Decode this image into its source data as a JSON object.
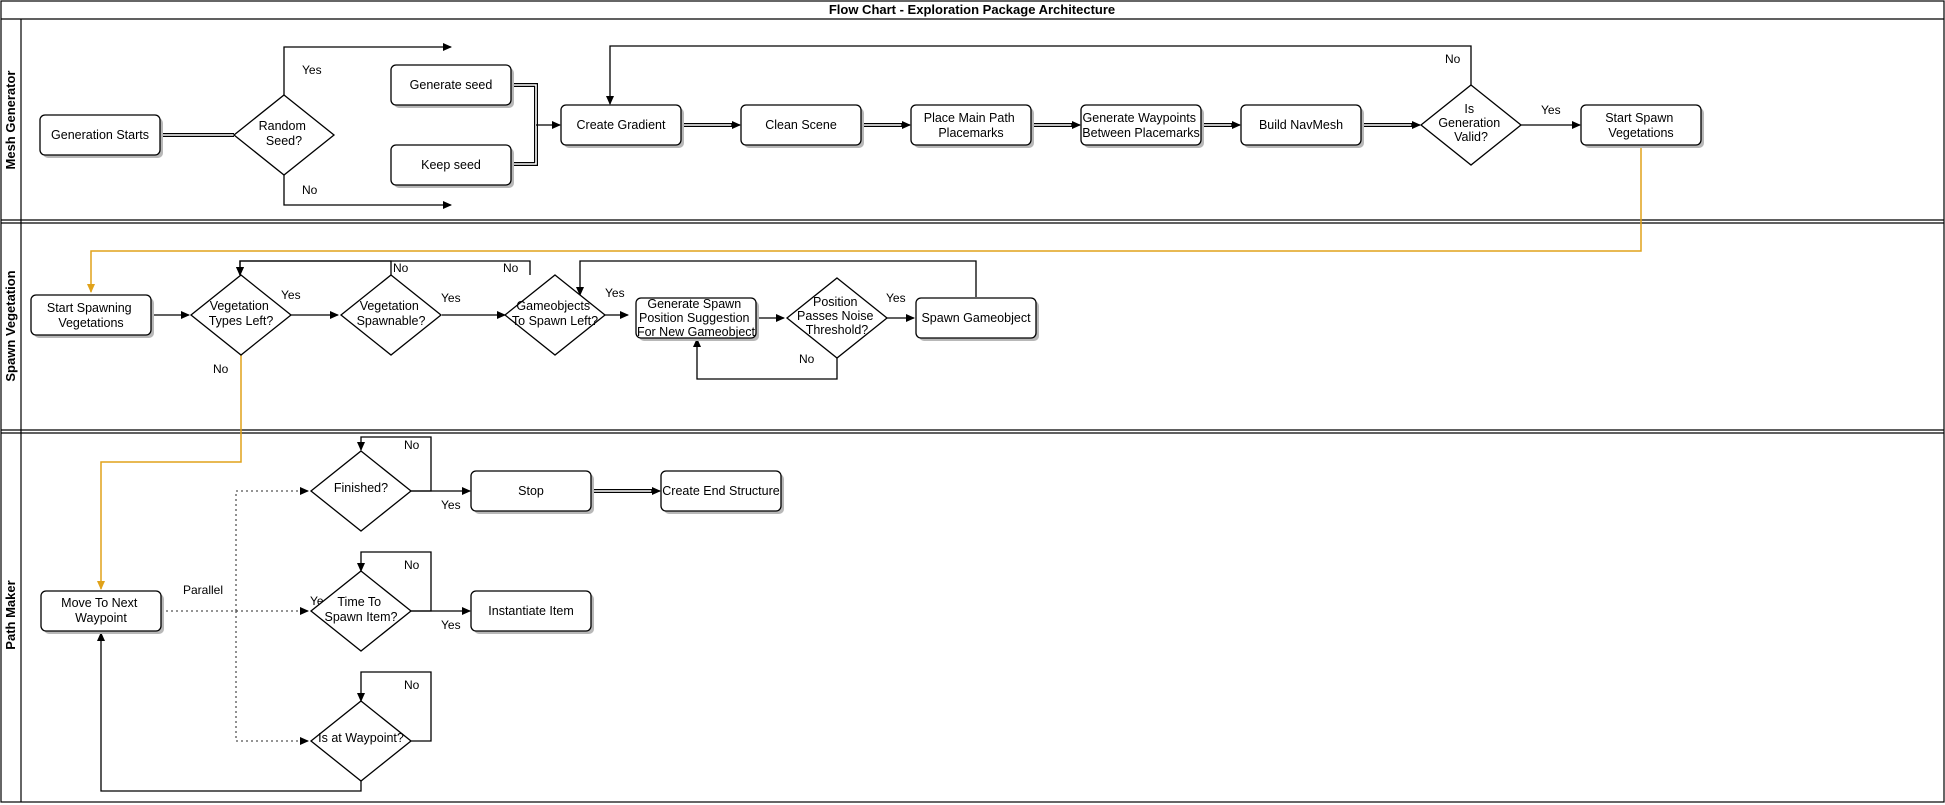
{
  "title": "Flow Chart - Exploration Package Architecture",
  "lanes": {
    "mesh": "Mesh Generator",
    "spawn": "Spawn Vegetation",
    "path": "Path Maker"
  },
  "nodes": {
    "generation_starts": "Generation Starts",
    "random_seed": [
      "Random",
      "Seed?"
    ],
    "generate_seed": "Generate seed",
    "keep_seed": "Keep seed",
    "create_gradient": "Create Gradient",
    "clean_scene": "Clean Scene",
    "place_main_path": [
      "Place Main Path",
      "Placemarks"
    ],
    "generate_waypoints": [
      "Generate Waypoints",
      "Between Placemarks"
    ],
    "build_navmesh": "Build NavMesh",
    "is_generation_valid": [
      "Is",
      "Generation",
      "Valid?"
    ],
    "start_spawn_vegetations": [
      "Start Spawn",
      "Vegetations"
    ],
    "start_spawning": [
      "Start Spawning",
      "Vegetations"
    ],
    "vegetation_types_left": [
      "Vegetation",
      "Types Left?"
    ],
    "vegetation_spawnable": [
      "Vegetation",
      "Spawnable?"
    ],
    "gameobjects_left": [
      "Gameobjects",
      "To Spawn Left?"
    ],
    "generate_spawn_position": [
      "Generate Spawn",
      "Position Suggestion",
      "For New Gameobject"
    ],
    "position_passes": [
      "Position",
      "Passes Noise",
      "Threshold?"
    ],
    "spawn_gameobject": "Spawn Gameobject",
    "finished": "Finished?",
    "stop": "Stop",
    "create_end_structure": "Create End Structure",
    "time_to_spawn": [
      "Time To",
      "Spawn Item?"
    ],
    "instantiate_item": "Instantiate Item",
    "is_at_waypoint": "Is at Waypoint?",
    "move_to_next": [
      "Move To Next",
      "Waypoint"
    ]
  },
  "edge_labels": {
    "yes": "Yes",
    "no": "No",
    "ye_partial": "Ye",
    "parallel": "Parallel"
  },
  "colors": {
    "orange_connector": "#e0a21a"
  }
}
